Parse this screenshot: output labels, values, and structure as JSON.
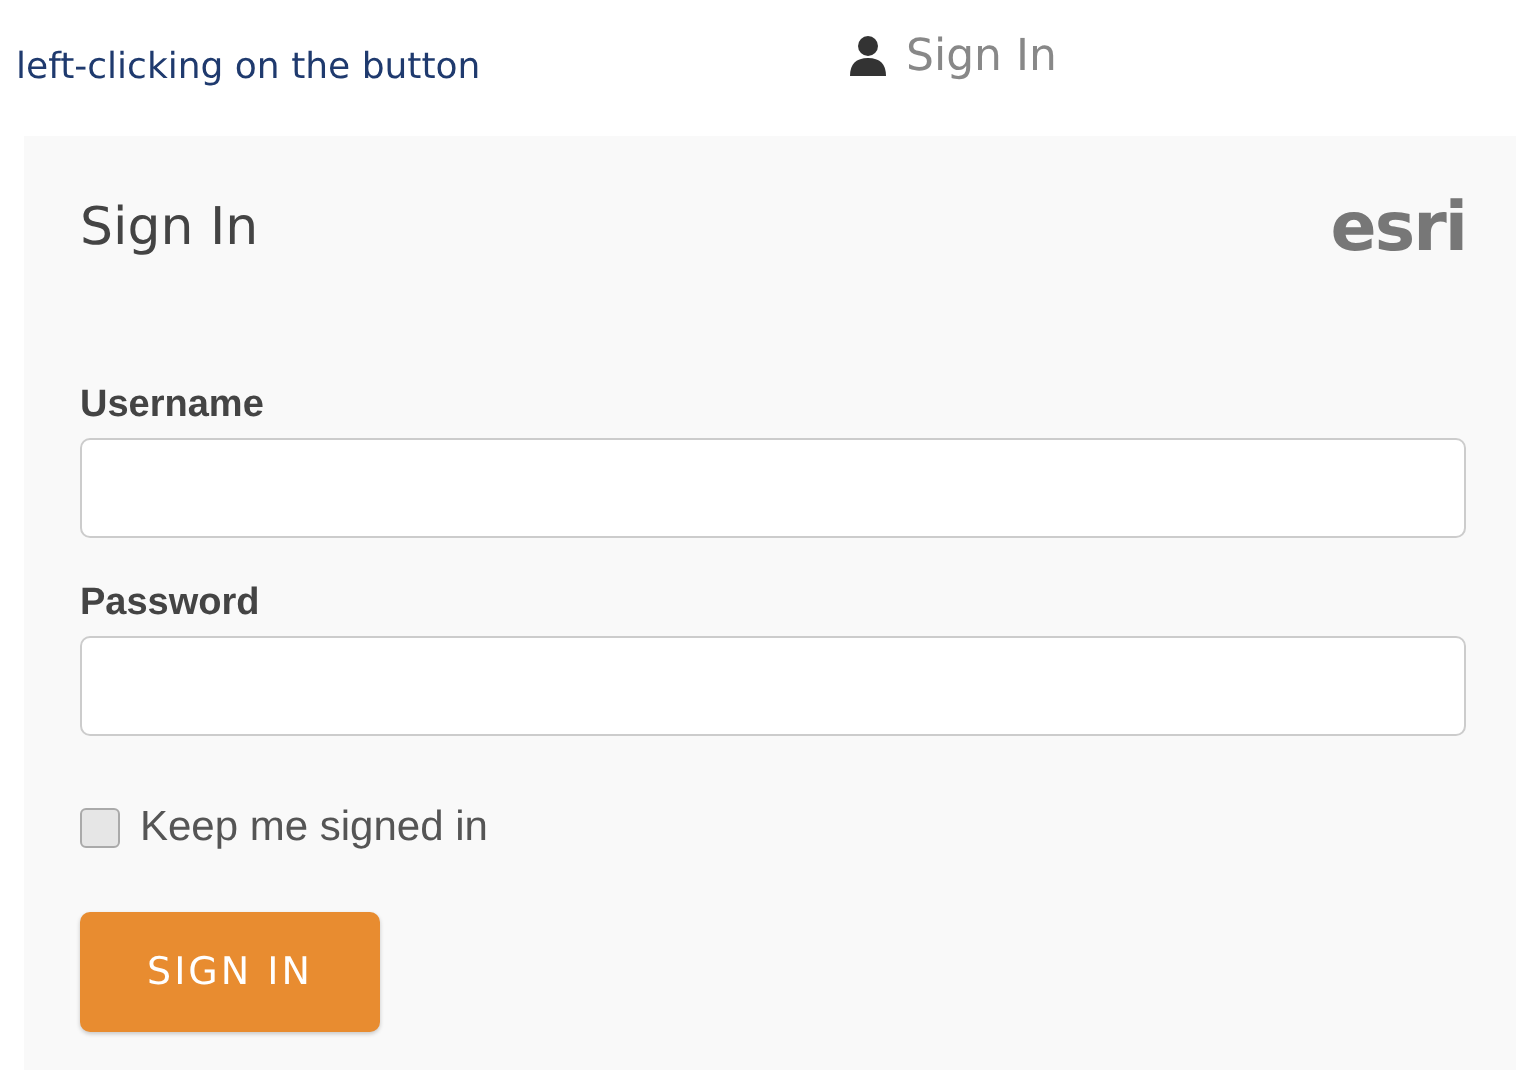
{
  "caption": "left-clicking on the button",
  "sign_in_link": {
    "label": "Sign In"
  },
  "dialog": {
    "title": "Sign In",
    "logo": "esri",
    "fields": [
      {
        "label": "Username"
      },
      {
        "label": "Password"
      }
    ],
    "keep_signed_in": {
      "label": "Keep me signed in",
      "checked": false
    },
    "submit": {
      "label": "SIGN IN"
    }
  }
}
